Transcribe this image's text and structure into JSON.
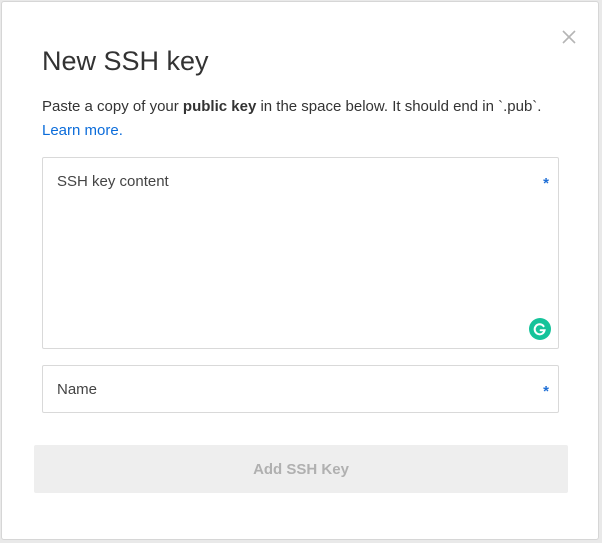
{
  "dialog": {
    "title": "New SSH key",
    "description_prefix": "Paste a copy of your ",
    "description_bold": "public key",
    "description_suffix": " in the space below. It should end in `.pub`.",
    "learn_more_label": "Learn more."
  },
  "fields": {
    "key_content": {
      "label": "SSH key content",
      "value": "",
      "required_marker": "*"
    },
    "name": {
      "label": "Name",
      "value": "",
      "required_marker": "*"
    }
  },
  "actions": {
    "submit_label": "Add SSH Key",
    "submit_enabled": false
  },
  "icons": {
    "close": "close-icon",
    "grammarly": "grammarly-icon"
  },
  "colors": {
    "link": "#0b6cda",
    "required": "#1f6fd6",
    "grammarly": "#15c39a",
    "button_disabled_bg": "#eeeeee",
    "button_disabled_text": "#b0b0b0"
  }
}
